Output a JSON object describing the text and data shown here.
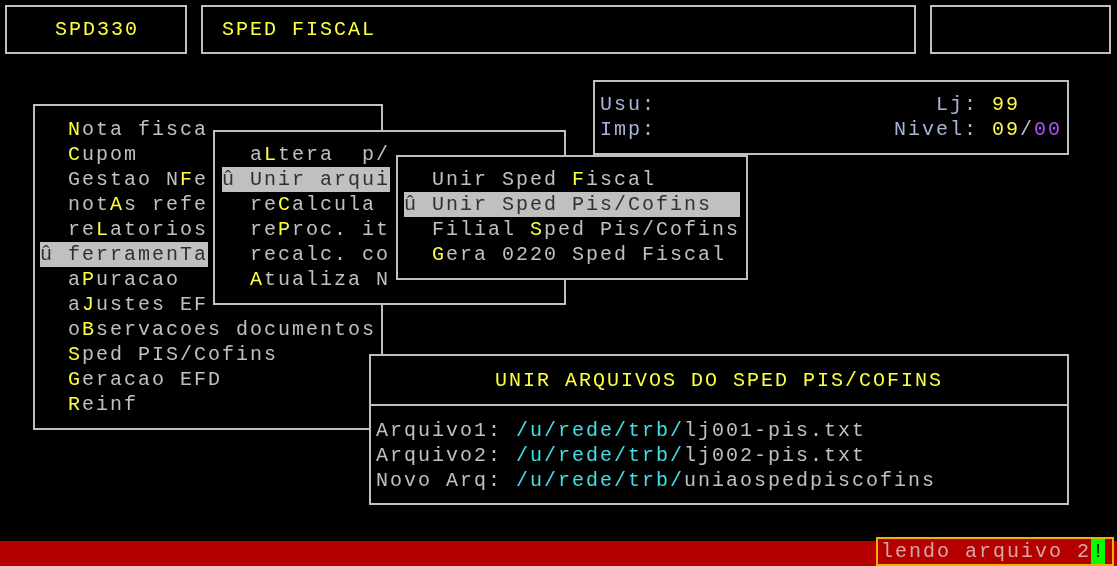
{
  "header": {
    "program_code": "SPD330",
    "title": "SPED FISCAL"
  },
  "info": {
    "user_label": "Usu:",
    "printer_label": "Imp:",
    "store_label": "Lj:",
    "store_value": "99",
    "level_label": "Nivel:",
    "level_major": "09",
    "level_separator": "/",
    "level_minor": "00"
  },
  "main_menu": [
    {
      "key": "N",
      "post": "ota fisca",
      "selected": false
    },
    {
      "key": "C",
      "post": "upom",
      "selected": false
    },
    {
      "pre": "Gestao N",
      "key": "F",
      "post": "e",
      "selected": false
    },
    {
      "pre": "not",
      "key": "A",
      "post": "s refe",
      "selected": false
    },
    {
      "pre": "re",
      "key": "L",
      "post": "atorios",
      "selected": false
    },
    {
      "mark": "û",
      "pre": "ferramen",
      "key": "T",
      "post": "a",
      "selected": true
    },
    {
      "pre": "a",
      "key": "P",
      "post": "uracao",
      "selected": false
    },
    {
      "pre": "a",
      "key": "J",
      "post": "ustes EF",
      "selected": false
    },
    {
      "pre": "o",
      "key": "B",
      "post": "servacoes documentos",
      "selected": false
    },
    {
      "key": "S",
      "post": "ped PIS/Cofins",
      "selected": false
    },
    {
      "key": "G",
      "post": "eracao EFD",
      "selected": false
    },
    {
      "key": "R",
      "post": "einf",
      "selected": false
    }
  ],
  "submenu": [
    {
      "pre": "a",
      "key": "L",
      "post": "tera  p/",
      "selected": false
    },
    {
      "mark": "û",
      "pre": "Unir arqui",
      "selected": true
    },
    {
      "pre": "re",
      "key": "C",
      "post": "alcula",
      "selected": false
    },
    {
      "pre": "re",
      "key": "P",
      "post": "roc. it",
      "selected": false
    },
    {
      "pre": "recalc. co",
      "selected": false
    },
    {
      "key": "A",
      "post": "tualiza N",
      "selected": false
    }
  ],
  "subsubmenu": [
    {
      "pre": "Unir Sped ",
      "key": "F",
      "post": "iscal",
      "selected": false
    },
    {
      "mark": "û",
      "pre": "Unir Sped Pis/Cofins",
      "selected": true
    },
    {
      "pre": "Filial ",
      "key": "S",
      "post": "ped Pis/Cofins",
      "selected": false
    },
    {
      "key": "G",
      "post": "era 0220 Sped Fiscal",
      "selected": false
    }
  ],
  "dialog": {
    "title": "UNIR ARQUIVOS DO SPED PIS/COFINS",
    "fields": [
      {
        "label": "Arquivo1:",
        "dir": "/u/rede/trb/",
        "file": "lj001-pis.txt"
      },
      {
        "label": "Arquivo2:",
        "dir": "/u/rede/trb/",
        "file": "lj002-pis.txt"
      },
      {
        "label": "Novo Arq:",
        "dir": "/u/rede/trb/",
        "file": "uniaospedpiscofins"
      }
    ]
  },
  "status": {
    "message": "lendo arquivo 2",
    "cursor": "!"
  }
}
